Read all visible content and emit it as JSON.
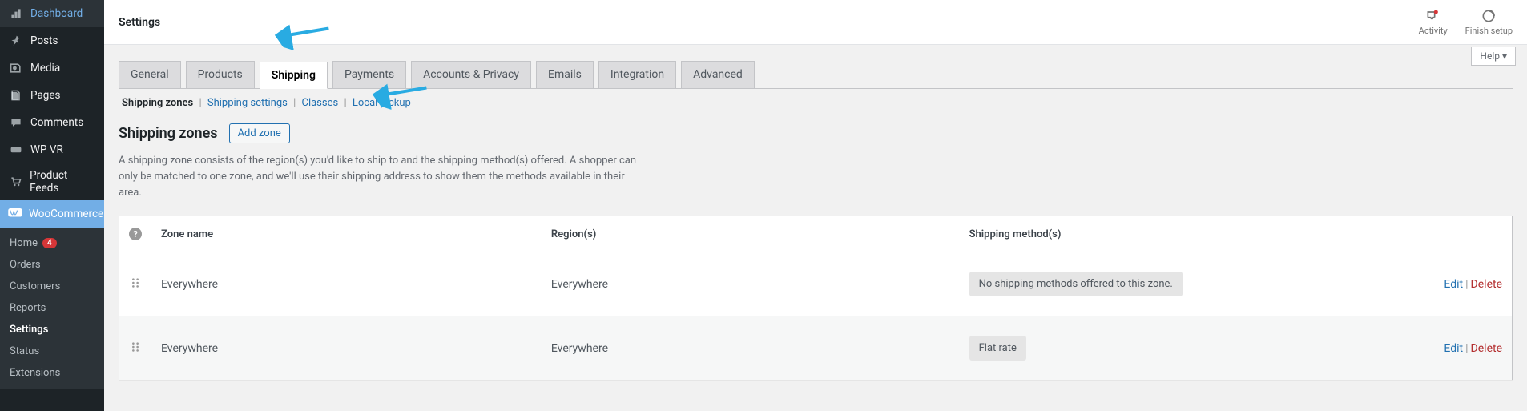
{
  "sidebar": {
    "items": [
      {
        "label": "Dashboard",
        "icon": "dashboard"
      },
      {
        "label": "Posts",
        "icon": "pin"
      },
      {
        "label": "Media",
        "icon": "media"
      },
      {
        "label": "Pages",
        "icon": "pages"
      },
      {
        "label": "Comments",
        "icon": "comment"
      },
      {
        "label": "WP VR",
        "icon": "vr"
      },
      {
        "label": "Product Feeds",
        "icon": "cart"
      },
      {
        "label": "WooCommerce",
        "icon": "woo"
      }
    ],
    "sub_items": [
      {
        "label": "Home",
        "badge": "4"
      },
      {
        "label": "Orders"
      },
      {
        "label": "Customers"
      },
      {
        "label": "Reports"
      },
      {
        "label": "Settings"
      },
      {
        "label": "Status"
      },
      {
        "label": "Extensions"
      }
    ]
  },
  "topbar": {
    "title": "Settings",
    "activity": "Activity",
    "finish_setup": "Finish setup",
    "help": "Help"
  },
  "tabs": [
    "General",
    "Products",
    "Shipping",
    "Payments",
    "Accounts & Privacy",
    "Emails",
    "Integration",
    "Advanced"
  ],
  "active_tab": 2,
  "subtabs": [
    "Shipping zones",
    "Shipping settings",
    "Classes",
    "Local pickup"
  ],
  "active_subtab": 0,
  "section": {
    "title": "Shipping zones",
    "add_button": "Add zone",
    "description": "A shipping zone consists of the region(s) you'd like to ship to and the shipping method(s) offered. A shopper can only be matched to one zone, and we'll use their shipping address to show them the methods available in their area."
  },
  "table": {
    "headers": [
      "Zone name",
      "Region(s)",
      "Shipping method(s)"
    ],
    "rows": [
      {
        "zone": "Everywhere",
        "region": "Everywhere",
        "method": "No shipping methods offered to this zone.",
        "edit": "Edit",
        "delete": "Delete"
      },
      {
        "zone": "Everywhere",
        "region": "Everywhere",
        "method": "Flat rate",
        "edit": "Edit",
        "delete": "Delete"
      }
    ]
  }
}
